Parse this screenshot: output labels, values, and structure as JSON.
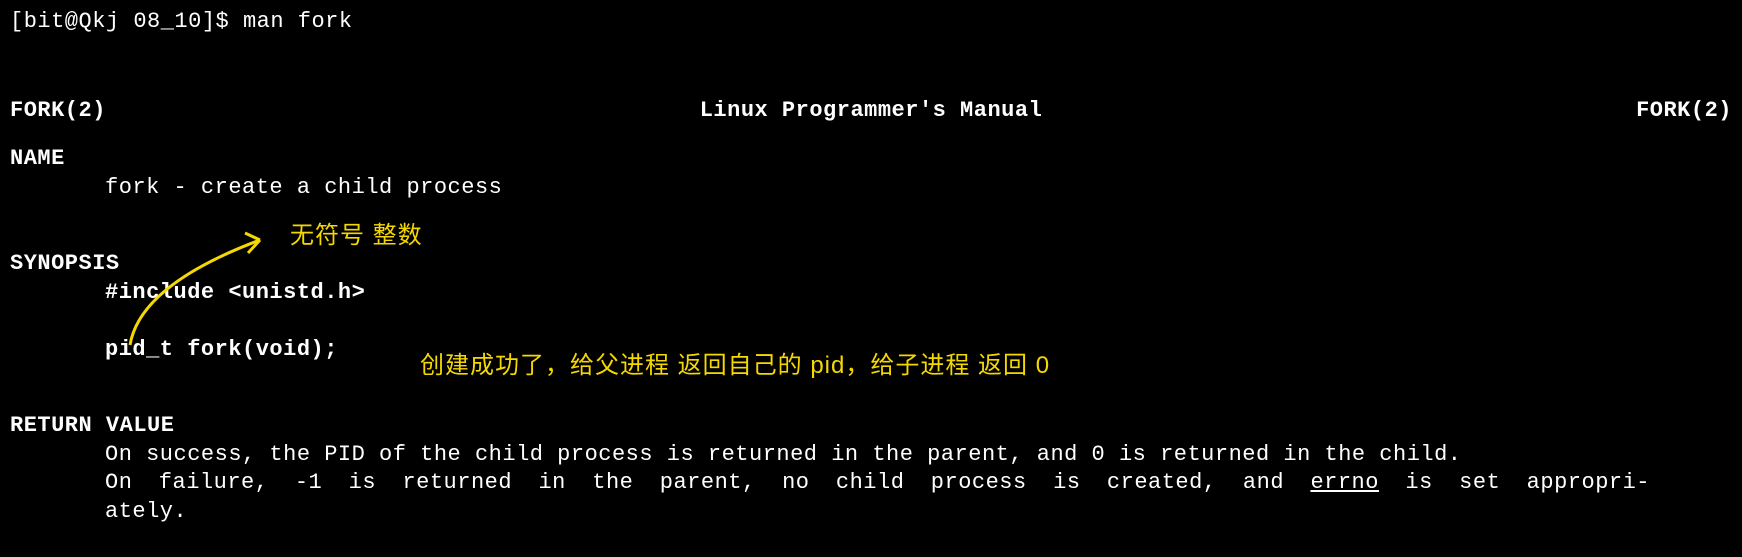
{
  "prompt": {
    "user_host": "[bit@Qkj 08_10]$",
    "command": "man fork"
  },
  "header": {
    "left": "FORK(2)",
    "center": "Linux Programmer's Manual",
    "right": "FORK(2)"
  },
  "sections": {
    "name": {
      "heading": "NAME",
      "content": "fork - create a child process"
    },
    "synopsis": {
      "heading": "SYNOPSIS",
      "include": "#include <unistd.h>",
      "prototype": "pid_t fork(void);"
    },
    "return_value": {
      "heading": "RETURN VALUE",
      "line1": "On  success,  the PID of the child process is returned in the parent, and 0 is returned in the child.",
      "line2a": "On failure, -1 is returned in the parent, no child process is created, and  ",
      "line2_errno": "errno",
      "line2b": "  is  set  appropri-",
      "line3": "ately."
    }
  },
  "annotations": {
    "a1": "无符号 整数",
    "a2": "创建成功了，给父进程 返回自己的 pid，给子进程 返回 0"
  }
}
